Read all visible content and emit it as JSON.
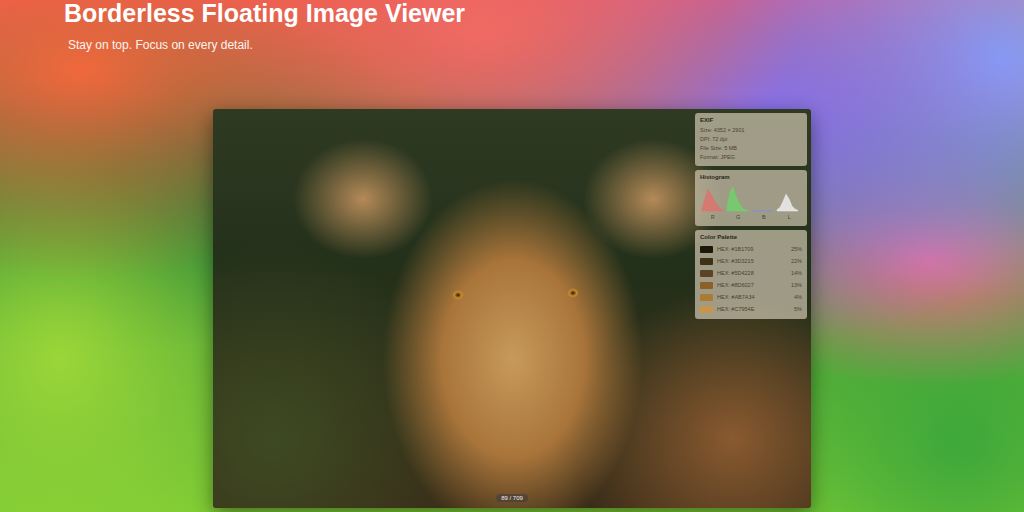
{
  "hero": {
    "title": "Borderless Floating Image Viewer",
    "subtitle": "Stay on top. Focus on every detail."
  },
  "viewer": {
    "counter": "89 / 709"
  },
  "exif": {
    "title": "EXIF",
    "rows": [
      "Size: 4352 × 2901",
      "DPI: 72 dpi",
      "File Size: 5 MB",
      "Format: JPEG"
    ]
  },
  "histogram": {
    "title": "Histogram",
    "series": [
      {
        "label": "R",
        "color": "#e0706a",
        "values": [
          0.1,
          0.5,
          0.9,
          0.7,
          0.45,
          0.25,
          0.1,
          0.02
        ]
      },
      {
        "label": "G",
        "color": "#6fd36a",
        "values": [
          0.2,
          0.8,
          1.0,
          0.6,
          0.35,
          0.15,
          0.05,
          0.01
        ]
      },
      {
        "label": "B",
        "color": "#7d8fe0",
        "values": [
          0.0,
          0.0,
          0.0,
          0.0,
          0.0,
          0.0,
          0.0,
          0.0
        ]
      },
      {
        "label": "L",
        "color": "#f2f2f2",
        "values": [
          0.05,
          0.15,
          0.4,
          0.7,
          0.5,
          0.2,
          0.08,
          0.02
        ]
      }
    ]
  },
  "palette": {
    "title": "Color Palette",
    "swatches": [
      {
        "hex": "HEX: #1B1709",
        "share": "25%",
        "color": "#1b1709"
      },
      {
        "hex": "HEX: #3D3215",
        "share": "22%",
        "color": "#3d3215"
      },
      {
        "hex": "HEX: #5D4228",
        "share": "14%",
        "color": "#5d4228"
      },
      {
        "hex": "HEX: #8D6027",
        "share": "13%",
        "color": "#8d6027"
      },
      {
        "hex": "HEX: #AB7A34",
        "share": "4%",
        "color": "#ab7a34"
      },
      {
        "hex": "HEX: #C7954E",
        "share": "5%",
        "color": "#c7954e"
      }
    ]
  }
}
